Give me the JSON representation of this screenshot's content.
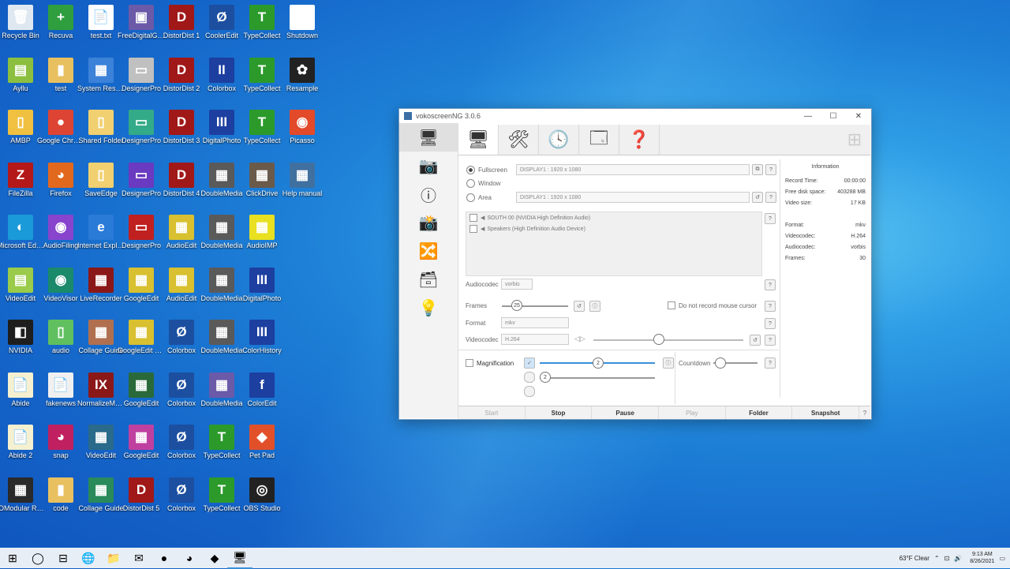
{
  "desktop": {
    "icons": [
      {
        "label": "Recycle Bin",
        "glyph": "🗑",
        "color": "#dfe8f0"
      },
      {
        "label": "Recuva",
        "glyph": "+",
        "color": "#2e9e3e"
      },
      {
        "label": "test.txt",
        "glyph": "📄",
        "color": "#ffffff"
      },
      {
        "label": "FreeDigitalGames",
        "glyph": "▣",
        "color": "#6a5aa8"
      },
      {
        "label": "DistorDist 1",
        "glyph": "D",
        "color": "#a01818"
      },
      {
        "label": "CoolerEdit",
        "glyph": "Ø",
        "color": "#1c4fa0"
      },
      {
        "label": "TypeCollect",
        "glyph": "T",
        "color": "#2b9a2b"
      },
      {
        "label": "Shutdown",
        "glyph": "◔",
        "color": "#ffffff"
      },
      {
        "label": "Ayllu",
        "glyph": "▤",
        "color": "#8cbf3f"
      },
      {
        "label": "test",
        "glyph": "▮",
        "color": "#e8c060"
      },
      {
        "label": "System Restore",
        "glyph": "▦",
        "color": "#3b82d8"
      },
      {
        "label": "DesignerPro",
        "glyph": "▭",
        "color": "#c0c0c0"
      },
      {
        "label": "DistorDist 2",
        "glyph": "D",
        "color": "#a01818"
      },
      {
        "label": "Colorbox",
        "glyph": "II",
        "color": "#1c3fa0"
      },
      {
        "label": "TypeCollect",
        "glyph": "T",
        "color": "#2b9a2b"
      },
      {
        "label": "Resample",
        "glyph": "✿",
        "color": "#222222"
      },
      {
        "label": "AMBP",
        "glyph": "▯",
        "color": "#f0c040"
      },
      {
        "label": "Google Chrome",
        "glyph": "●",
        "color": "#dd4433"
      },
      {
        "label": "Shared Folder",
        "glyph": "▯",
        "color": "#f0d070"
      },
      {
        "label": "DesignerPro",
        "glyph": "▭",
        "color": "#33aa88"
      },
      {
        "label": "DistorDist 3",
        "glyph": "D",
        "color": "#a01818"
      },
      {
        "label": "DigitalPhoto",
        "glyph": "III",
        "color": "#1c3fa0"
      },
      {
        "label": "TypeCollect",
        "glyph": "T",
        "color": "#2b9a2b"
      },
      {
        "label": "Picasso",
        "glyph": "◉",
        "color": "#e24a2a"
      },
      {
        "label": "FileZilla",
        "glyph": "Z",
        "color": "#b41818"
      },
      {
        "label": "Firefox",
        "glyph": "◕",
        "color": "#e2681e"
      },
      {
        "label": "SaveEdge",
        "glyph": "▯",
        "color": "#f0d070"
      },
      {
        "label": "DesignerPro",
        "glyph": "▭",
        "color": "#6a3ac0"
      },
      {
        "label": "DistorDist 4",
        "glyph": "D",
        "color": "#a01818"
      },
      {
        "label": "DoubleMedia",
        "glyph": "▦",
        "color": "#5a5a5a"
      },
      {
        "label": "ClickDrive",
        "glyph": "▦",
        "color": "#6a5a4a"
      },
      {
        "label": "Help manual",
        "glyph": "▦",
        "color": "#4070a0"
      },
      {
        "label": "Microsoft Edge",
        "glyph": "◐",
        "color": "#1a9ad8"
      },
      {
        "label": "AudioFiling",
        "glyph": "◉",
        "color": "#8844cc"
      },
      {
        "label": "Internet Explorer",
        "glyph": "e",
        "color": "#2a7ad8"
      },
      {
        "label": "DesignerPro",
        "glyph": "▭",
        "color": "#c02020"
      },
      {
        "label": "AudioEdit",
        "glyph": "▦",
        "color": "#d8c030"
      },
      {
        "label": "DoubleMedia",
        "glyph": "▦",
        "color": "#5a5a5a"
      },
      {
        "label": "AudioIMP",
        "glyph": "▦",
        "color": "#e8e020"
      },
      {
        "label": "",
        "glyph": "",
        "color": "transparent"
      },
      {
        "label": "VideoEdit",
        "glyph": "▤",
        "color": "#9acb4a"
      },
      {
        "label": "VideoVisor",
        "glyph": "◉",
        "color": "#1a8a6a"
      },
      {
        "label": "LiveRecorder",
        "glyph": "▦",
        "color": "#8a1818"
      },
      {
        "label": "GoogleEdit",
        "glyph": "▦",
        "color": "#d8c030"
      },
      {
        "label": "AudioEdit",
        "glyph": "▦",
        "color": "#d8c030"
      },
      {
        "label": "DoubleMedia",
        "glyph": "▦",
        "color": "#5a5a5a"
      },
      {
        "label": "DigitalPhoto",
        "glyph": "III",
        "color": "#1c3fa0"
      },
      {
        "label": "",
        "glyph": "",
        "color": "transparent"
      },
      {
        "label": "NVIDIA",
        "glyph": "◧",
        "color": "#1e1e1e"
      },
      {
        "label": "audio",
        "glyph": "▯",
        "color": "#60c060"
      },
      {
        "label": "Collage Guide",
        "glyph": "▦",
        "color": "#b07050"
      },
      {
        "label": "GoogleEdit Service",
        "glyph": "▦",
        "color": "#d8c030"
      },
      {
        "label": "Colorbox",
        "glyph": "Ø",
        "color": "#1c4fa0"
      },
      {
        "label": "DoubleMedia",
        "glyph": "▦",
        "color": "#5a5a5a"
      },
      {
        "label": "ColorHistory",
        "glyph": "III",
        "color": "#1c3fa0"
      },
      {
        "label": "",
        "glyph": "",
        "color": "transparent"
      },
      {
        "label": "Abide",
        "glyph": "📄",
        "color": "#f4f0d0"
      },
      {
        "label": "fakenews",
        "glyph": "📄",
        "color": "#f0f0f0"
      },
      {
        "label": "NormalizeMedia",
        "glyph": "IX",
        "color": "#8a1818"
      },
      {
        "label": "GoogleEdit",
        "glyph": "▦",
        "color": "#2a6a3a"
      },
      {
        "label": "Colorbox",
        "glyph": "Ø",
        "color": "#1c4fa0"
      },
      {
        "label": "DoubleMedia",
        "glyph": "▦",
        "color": "#6a5aa8"
      },
      {
        "label": "ColorEdit",
        "glyph": "f",
        "color": "#1c3fa0"
      },
      {
        "label": "",
        "glyph": "",
        "color": "transparent"
      },
      {
        "label": "Abide 2",
        "glyph": "📄",
        "color": "#f4f0d0"
      },
      {
        "label": "snap",
        "glyph": "◕",
        "color": "#c02060"
      },
      {
        "label": "VideoEdit",
        "glyph": "▦",
        "color": "#2a6a8a"
      },
      {
        "label": "GoogleEdit",
        "glyph": "▦",
        "color": "#c040a0"
      },
      {
        "label": "Colorbox",
        "glyph": "Ø",
        "color": "#1c4fa0"
      },
      {
        "label": "TypeCollect",
        "glyph": "T",
        "color": "#2b9a2b"
      },
      {
        "label": "Pet Pad",
        "glyph": "◆",
        "color": "#e2502a"
      },
      {
        "label": "",
        "glyph": "",
        "color": "transparent"
      },
      {
        "label": "IDModular Recorder",
        "glyph": "▦",
        "color": "#2a2a2a"
      },
      {
        "label": "code",
        "glyph": "▮",
        "color": "#e8c060"
      },
      {
        "label": "Collage Guide",
        "glyph": "▦",
        "color": "#2a8a5a"
      },
      {
        "label": "DistorDist 5",
        "glyph": "D",
        "color": "#a01818"
      },
      {
        "label": "Colorbox",
        "glyph": "Ø",
        "color": "#1c4fa0"
      },
      {
        "label": "TypeCollect",
        "glyph": "T",
        "color": "#2b9a2b"
      },
      {
        "label": "OBS Studio",
        "glyph": "◎",
        "color": "#222222"
      },
      {
        "label": "",
        "glyph": "",
        "color": "transparent"
      }
    ]
  },
  "window": {
    "title": "vokoscreenNG 3.0.6",
    "controls": [
      "—",
      "☐",
      "✕"
    ],
    "left_tools": [
      "🖥",
      "📷",
      "ⓘ",
      "📸",
      "🔀",
      "🗃",
      "💡"
    ],
    "tabs": [
      "🖥",
      "🛠",
      "🕓",
      "🗔",
      "❓"
    ],
    "capture": {
      "fullscreen_label": "Fullscreen",
      "fullscreen_value": "DISPLAY1 : 1920 x 1080",
      "window_label": "Window",
      "area_label": "Area",
      "area_value": "DISPLAY1 : 1920 x 1080"
    },
    "audio_devices": [
      "SOUTH 00 (NVIDIA High Definition Audio)",
      "Speakers (High Definition Audio Device)"
    ],
    "audiocodec_label": "Audiocodec",
    "audiocodec_value": "vorbis",
    "frames_label": "Frames",
    "frames_value": "25",
    "mouse_cursor_label": "Do not record mouse cursor",
    "format_label": "Format",
    "format_value": "mkv",
    "videocodec_label": "Videocodec",
    "videocodec_value": "H.264",
    "magnification_label": "Magnification",
    "countdown_label": "Countdown",
    "info": {
      "title": "Information",
      "rows": [
        {
          "k": "Record Time:",
          "v": "00:00:00"
        },
        {
          "k": "Free disk space:",
          "v": "403288 MB"
        },
        {
          "k": "Video size:",
          "v": "17 KB"
        },
        {
          "k": "",
          "v": ""
        },
        {
          "k": "Format:",
          "v": "mkv"
        },
        {
          "k": "Videocodec:",
          "v": "H.264"
        },
        {
          "k": "Audiocodec:",
          "v": "vorbis"
        },
        {
          "k": "Frames:",
          "v": "30"
        }
      ]
    },
    "buttons": [
      "Start",
      "Stop",
      "Pause",
      "Play",
      "Folder",
      "Snapshot"
    ]
  },
  "taskbar": {
    "items": [
      "⊞",
      "◯",
      "⊟",
      "🌐",
      "📁",
      "✉",
      "●",
      "◕",
      "◆",
      "🖥"
    ],
    "weather": "63°F Clear",
    "time": "9:13 AM",
    "date": "8/26/2021"
  }
}
